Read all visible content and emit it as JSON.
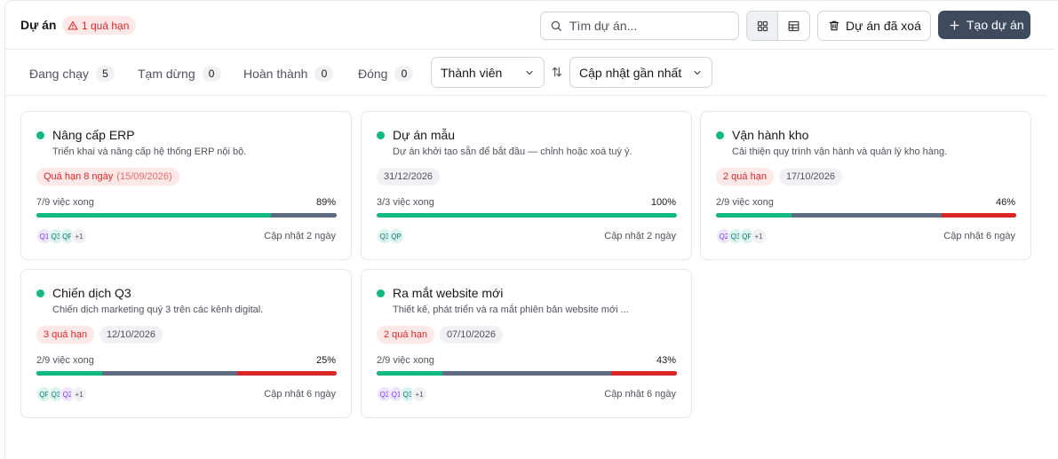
{
  "header": {
    "title": "Dự án",
    "overdue_badge": "1 quá hạn",
    "search_placeholder": "Tìm dự án...",
    "deleted_label": "Dự án đã xoá",
    "create_label": "Tạo dự án",
    "view_mode": "grid"
  },
  "filters": {
    "tabs": [
      {
        "label": "Đang chạy",
        "count": "5"
      },
      {
        "label": "Tạm dừng",
        "count": "0"
      },
      {
        "label": "Hoàn thành",
        "count": "0"
      },
      {
        "label": "Đóng",
        "count": "0"
      }
    ],
    "member_select": "Thành viên",
    "sort_select": "Cập nhật gần nhất"
  },
  "colors": {
    "accent": "#3f4a5e",
    "status_green": "#10b981",
    "overdue_red": "#dc2626",
    "pending_slate": "#5f6b80"
  },
  "projects": [
    {
      "name": "Nâng cấp ERP",
      "description": "Triển khai và nâng cấp hệ thống ERP nội bộ.",
      "chips": [
        {
          "text": "Quá hạn 8 ngày",
          "sub": "(15/09/2026)",
          "tone": "red"
        }
      ],
      "done_text": "7/9 việc xong",
      "percent": "89%",
      "progress": {
        "done": 0.78,
        "pending": 0.22,
        "overdue": 0
      },
      "avatars": [
        {
          "t": "Q1",
          "c": "purple"
        },
        {
          "t": "Q3",
          "c": "teal"
        },
        {
          "t": "QP",
          "c": "teal"
        },
        {
          "t": "+1",
          "c": "more"
        }
      ],
      "updated": "Cập nhật 2 ngày"
    },
    {
      "name": "Dự án mẫu",
      "description": "Dự án khởi tạo sẵn để bắt đầu — chỉnh hoặc xoá tuỳ ý.",
      "chips": [
        {
          "text": "31/12/2026",
          "sub": "",
          "tone": "grey"
        }
      ],
      "done_text": "3/3 việc xong",
      "percent": "100%",
      "progress": {
        "done": 1.0,
        "pending": 0,
        "overdue": 0
      },
      "avatars": [
        {
          "t": "Q3",
          "c": "teal"
        },
        {
          "t": "QP",
          "c": "teal"
        }
      ],
      "updated": "Cập nhật 2 ngày"
    },
    {
      "name": "Vận hành kho",
      "description": "Cải thiện quy trình vận hành và quản lý kho hàng.",
      "chips": [
        {
          "text": "2 quá hạn",
          "sub": "",
          "tone": "red"
        },
        {
          "text": "17/10/2026",
          "sub": "",
          "tone": "grey"
        }
      ],
      "done_text": "2/9 việc xong",
      "percent": "46%",
      "progress": {
        "done": 0.25,
        "pending": 0.5,
        "overdue": 0.25
      },
      "avatars": [
        {
          "t": "Q2",
          "c": "purple"
        },
        {
          "t": "Q3",
          "c": "teal"
        },
        {
          "t": "QP",
          "c": "teal"
        },
        {
          "t": "+1",
          "c": "more"
        }
      ],
      "updated": "Cập nhật 6 ngày"
    },
    {
      "name": "Chiến dịch Q3",
      "description": "Chiến dịch marketing quý 3 trên các kênh digital.",
      "chips": [
        {
          "text": "3 quá hạn",
          "sub": "",
          "tone": "red"
        },
        {
          "text": "12/10/2026",
          "sub": "",
          "tone": "grey"
        }
      ],
      "done_text": "2/9 việc xong",
      "percent": "25%",
      "progress": {
        "done": 0.22,
        "pending": 0.45,
        "overdue": 0.33
      },
      "avatars": [
        {
          "t": "QP",
          "c": "teal"
        },
        {
          "t": "Q3",
          "c": "teal"
        },
        {
          "t": "Q2",
          "c": "purple"
        },
        {
          "t": "+1",
          "c": "more"
        }
      ],
      "updated": "Cập nhật 6 ngày"
    },
    {
      "name": "Ra mắt website mới",
      "description": "Thiết kế, phát triển và ra mắt phiên bản website mới ...",
      "chips": [
        {
          "text": "2 quá hạn",
          "sub": "",
          "tone": "red"
        },
        {
          "text": "07/10/2026",
          "sub": "",
          "tone": "grey"
        }
      ],
      "done_text": "2/9 việc xong",
      "percent": "43%",
      "progress": {
        "done": 0.22,
        "pending": 0.56,
        "overdue": 0.22
      },
      "avatars": [
        {
          "t": "Q2",
          "c": "purple"
        },
        {
          "t": "Q1",
          "c": "purple"
        },
        {
          "t": "Q3",
          "c": "teal"
        },
        {
          "t": "+1",
          "c": "more"
        }
      ],
      "updated": "Cập nhật 6 ngày"
    }
  ]
}
